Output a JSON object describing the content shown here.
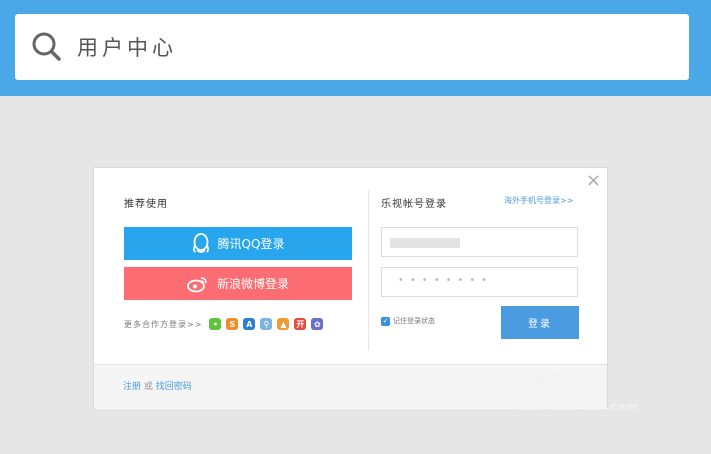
{
  "header": {
    "title": "用户中心",
    "search_icon": "search-icon"
  },
  "dialog": {
    "close_symbol": "×",
    "left": {
      "title": "推荐使用",
      "qq_button": "腾讯QQ登录",
      "weibo_button": "新浪微博登录",
      "more_label": "更多合作方登录>>",
      "partners": [
        {
          "name": "wechat-icon",
          "glyph": "•",
          "color": "#61c33d"
        },
        {
          "name": "partner-2-icon",
          "glyph": "S",
          "color": "#f08d2a"
        },
        {
          "name": "partner-3-icon",
          "glyph": "A",
          "color": "#2f7fd1"
        },
        {
          "name": "partner-4-icon",
          "glyph": "⚲",
          "color": "#7fb3df"
        },
        {
          "name": "partner-5-icon",
          "glyph": "▲",
          "color": "#f09a3a"
        },
        {
          "name": "partner-6-icon",
          "glyph": "开",
          "color": "#e8493b"
        },
        {
          "name": "baidu-icon",
          "glyph": "✿",
          "color": "#6a6fc7"
        }
      ]
    },
    "right": {
      "title": "乐视帐号登录",
      "oversea_link": "海外手机号登录>>",
      "username_value": "",
      "password_mask": "••••••••",
      "remember_label": "记住登录状态",
      "login_button": "登录"
    },
    "footer": {
      "register": "注册",
      "or": "或",
      "recover": "找回密码"
    }
  },
  "watermark": {
    "sub": "智能电视网",
    "main": "ZNDS",
    "suffix": ".com"
  }
}
